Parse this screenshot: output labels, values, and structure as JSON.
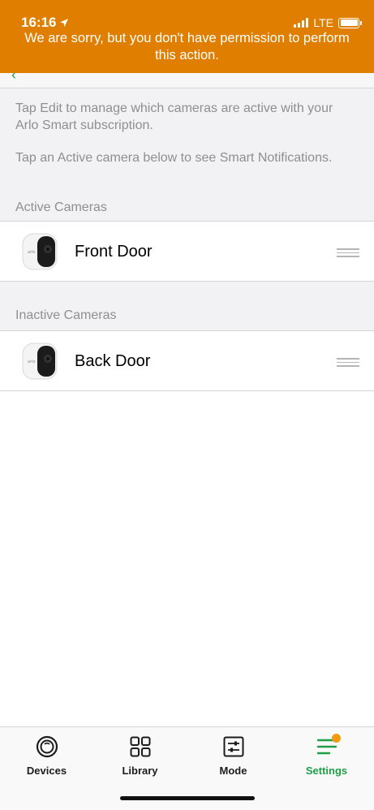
{
  "status_bar": {
    "time": "16:16",
    "network": "LTE"
  },
  "banner": {
    "message": "We are sorry, but you don't have permission to perform this action.",
    "color": "#e07e00"
  },
  "info": {
    "line1": "Tap Edit to manage which cameras are active with your Arlo Smart subscription.",
    "line2": "Tap an Active camera below to see Smart Notifications."
  },
  "sections": {
    "active_label": "Active Cameras",
    "inactive_label": "Inactive Cameras"
  },
  "active_cameras": [
    {
      "name": "Front Door"
    }
  ],
  "inactive_cameras": [
    {
      "name": "Back Door"
    }
  ],
  "tabbar": {
    "tabs": [
      {
        "label": "Devices",
        "icon": "devices-icon"
      },
      {
        "label": "Library",
        "icon": "library-icon"
      },
      {
        "label": "Mode",
        "icon": "mode-icon"
      },
      {
        "label": "Settings",
        "icon": "settings-icon",
        "active": true
      }
    ],
    "accent": "#1f9e47"
  }
}
